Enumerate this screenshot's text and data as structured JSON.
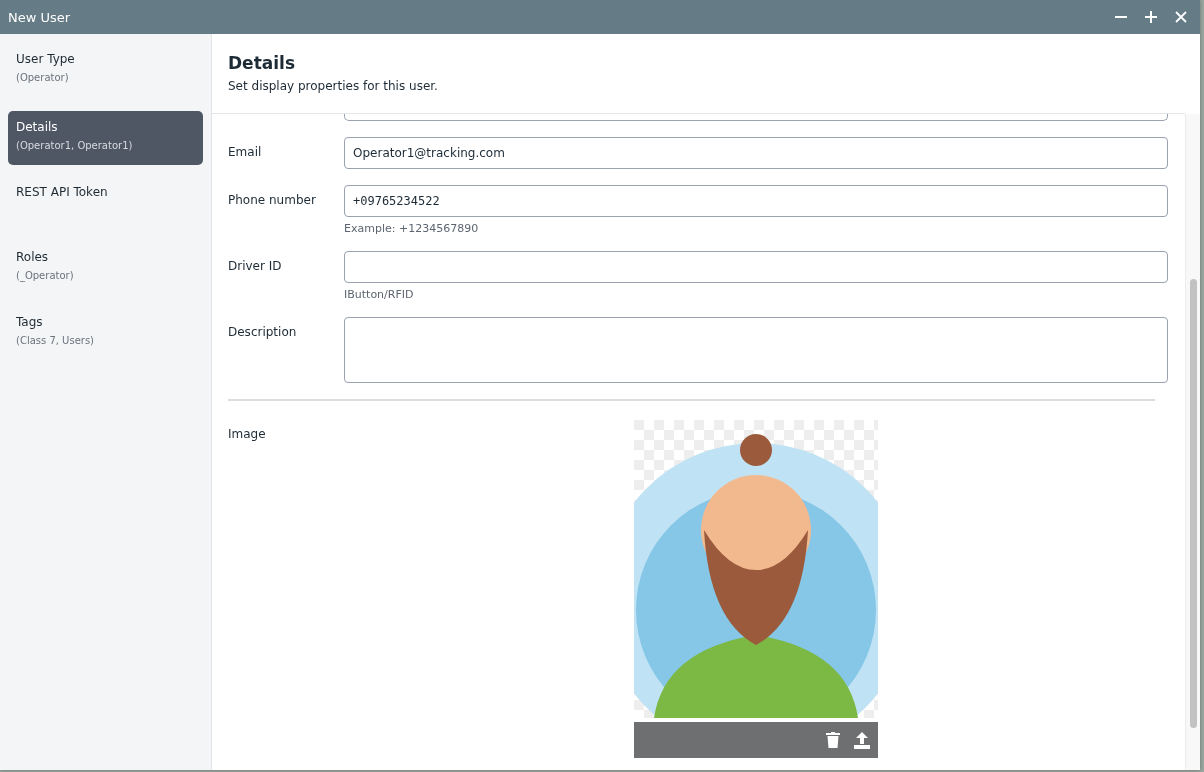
{
  "window": {
    "title": "New User"
  },
  "sidebar": {
    "items": [
      {
        "label": "User Type",
        "summary": "(Operator)",
        "selected": false
      },
      {
        "label": "Details",
        "summary": "(Operator1, Operator1)",
        "selected": true
      },
      {
        "label": "REST API Token",
        "selected": false
      },
      {
        "label": "Roles",
        "summary": "(_Operator)",
        "selected": false
      },
      {
        "label": "Tags",
        "summary": "(Class 7, Users)",
        "selected": false
      }
    ]
  },
  "header": {
    "title": "Details",
    "subtitle": "Set display properties for this user."
  },
  "fields": [
    {
      "kind": "text",
      "label": "Email",
      "value": "Operator1@tracking.com"
    },
    {
      "kind": "mono",
      "label": "Phone number",
      "value": "+09765234522",
      "hint": "Example: +1234567890"
    },
    {
      "kind": "text",
      "label": "Driver ID",
      "hint": "IButton/RFID"
    },
    {
      "kind": "area",
      "label": "Description"
    }
  ],
  "image": {
    "label": "Image"
  }
}
